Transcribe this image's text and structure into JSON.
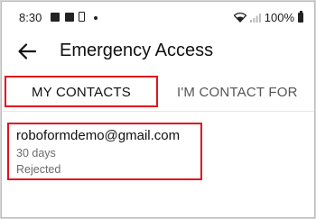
{
  "status_bar": {
    "time": "8:30",
    "battery_percent": "100%",
    "icons": [
      "gallery-icon",
      "mail-icon",
      "sim-icon",
      "notification-dot-icon",
      "wifi-icon",
      "signal-icon",
      "battery-icon"
    ]
  },
  "app_bar": {
    "title": "Emergency Access",
    "back_icon": "arrow-left-icon"
  },
  "tabs": [
    {
      "label": "MY CONTACTS",
      "selected": true
    },
    {
      "label": "I'M CONTACT FOR",
      "selected": false
    }
  ],
  "contacts": [
    {
      "email": "roboformdemo@gmail.com",
      "period": "30 days",
      "status": "Rejected"
    }
  ],
  "colors": {
    "highlight": "#e0141e",
    "text_primary": "#111111",
    "text_secondary": "#6b6b6b"
  }
}
